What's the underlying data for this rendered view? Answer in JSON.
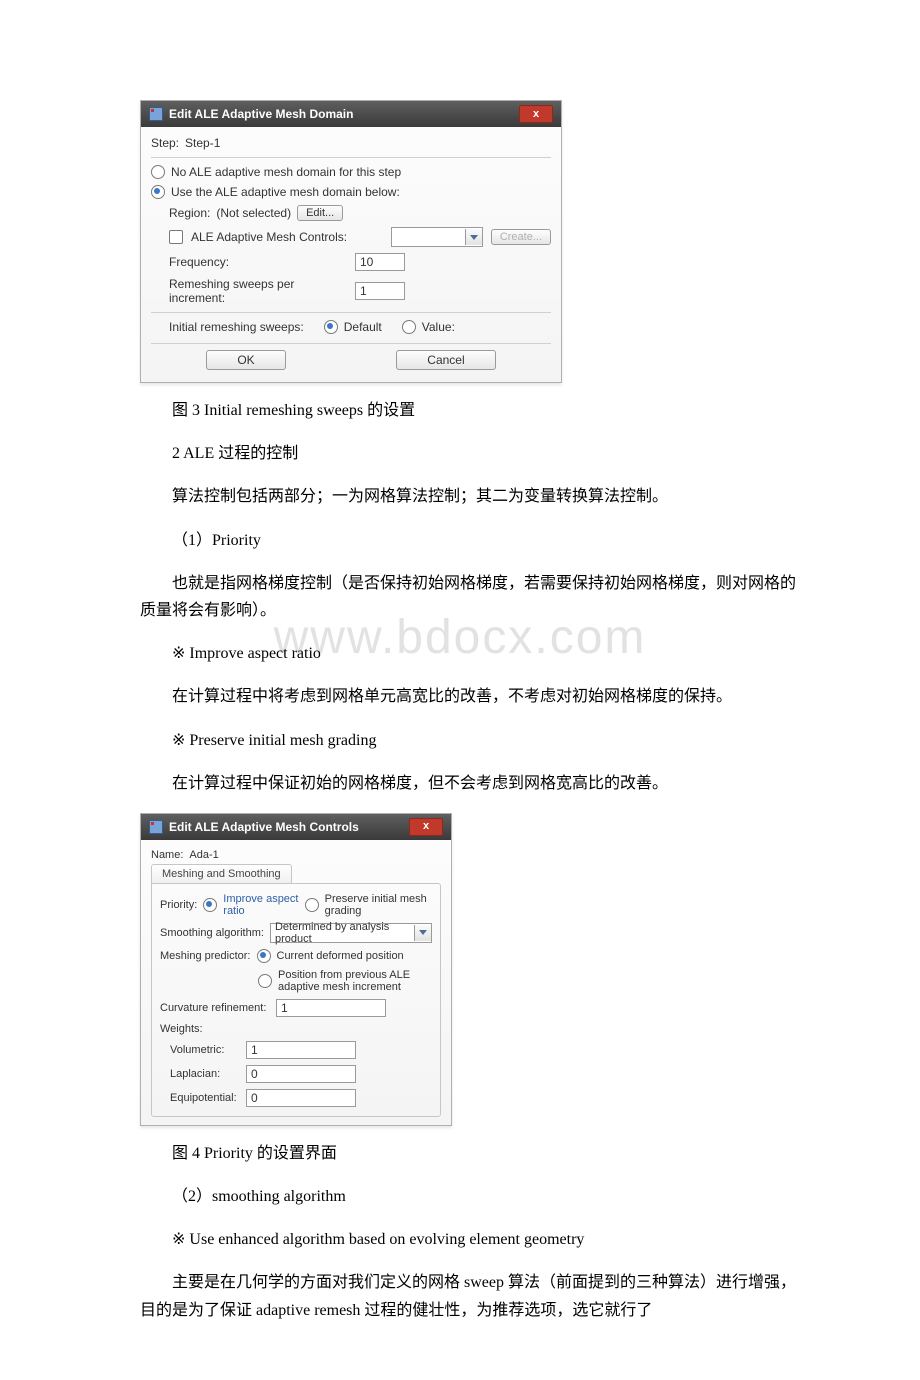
{
  "dialog1": {
    "title": "Edit ALE Adaptive Mesh Domain",
    "step_label": "Step:",
    "step_value": "Step-1",
    "opt_no_domain": "No ALE adaptive mesh domain for this step",
    "opt_use_domain": "Use the ALE adaptive mesh domain below:",
    "region_label": "Region:",
    "region_value": "(Not selected)",
    "edit_btn": "Edit...",
    "controls_label": "ALE Adaptive Mesh Controls:",
    "create_btn": "Create...",
    "frequency_label": "Frequency:",
    "frequency_value": "10",
    "sweeps_label": "Remeshing sweeps per increment:",
    "sweeps_value": "1",
    "init_sweeps_label": "Initial remeshing sweeps:",
    "default_label": "Default",
    "value_label": "Value:",
    "ok": "OK",
    "cancel": "Cancel"
  },
  "dialog2": {
    "title": "Edit ALE Adaptive Mesh Controls",
    "name_label": "Name:",
    "name_value": "Ada-1",
    "tab_label": "Meshing and Smoothing",
    "priority_label": "Priority:",
    "opt_improve": "Improve aspect ratio",
    "opt_preserve": "Preserve initial mesh grading",
    "smoothing_label": "Smoothing algorithm:",
    "smoothing_value": "Determined by analysis product",
    "predictor_label": "Meshing predictor:",
    "opt_current": "Current deformed position",
    "opt_previous": "Position from previous ALE adaptive mesh increment",
    "curvature_label": "Curvature refinement:",
    "curvature_value": "1",
    "weights_label": "Weights:",
    "volumetric_label": "Volumetric:",
    "volumetric_value": "1",
    "laplacian_label": "Laplacian:",
    "laplacian_value": "0",
    "equipotential_label": "Equipotential:",
    "equipotential_value": "0"
  },
  "text": {
    "fig3": "图 3 Initial remeshing sweeps 的设置",
    "p2": "2 ALE 过程的控制",
    "p3": "算法控制包括两部分；一为网格算法控制；其二为变量转换算法控制。",
    "p4": "（1）Priority",
    "p5": "也就是指网格梯度控制（是否保持初始网格梯度，若需要保持初始网格梯度，则对网格的质量将会有影响）。",
    "p6": "※ Improve aspect ratio",
    "p7": "在计算过程中将考虑到网格单元高宽比的改善，不考虑对初始网格梯度的保持。",
    "p8": "※ Preserve initial mesh grading",
    "p9": "在计算过程中保证初始的网格梯度，但不会考虑到网格宽高比的改善。",
    "fig4": "图 4 Priority 的设置界面",
    "p10": "（2）smoothing algorithm",
    "p11": "※ Use enhanced algorithm based on evolving element geometry",
    "p12": "主要是在几何学的方面对我们定义的网格 sweep 算法（前面提到的三种算法）进行增强，目的是为了保证 adaptive remesh 过程的健壮性，为推荐选项，选它就行了"
  },
  "watermark": "www.bdocx.com"
}
